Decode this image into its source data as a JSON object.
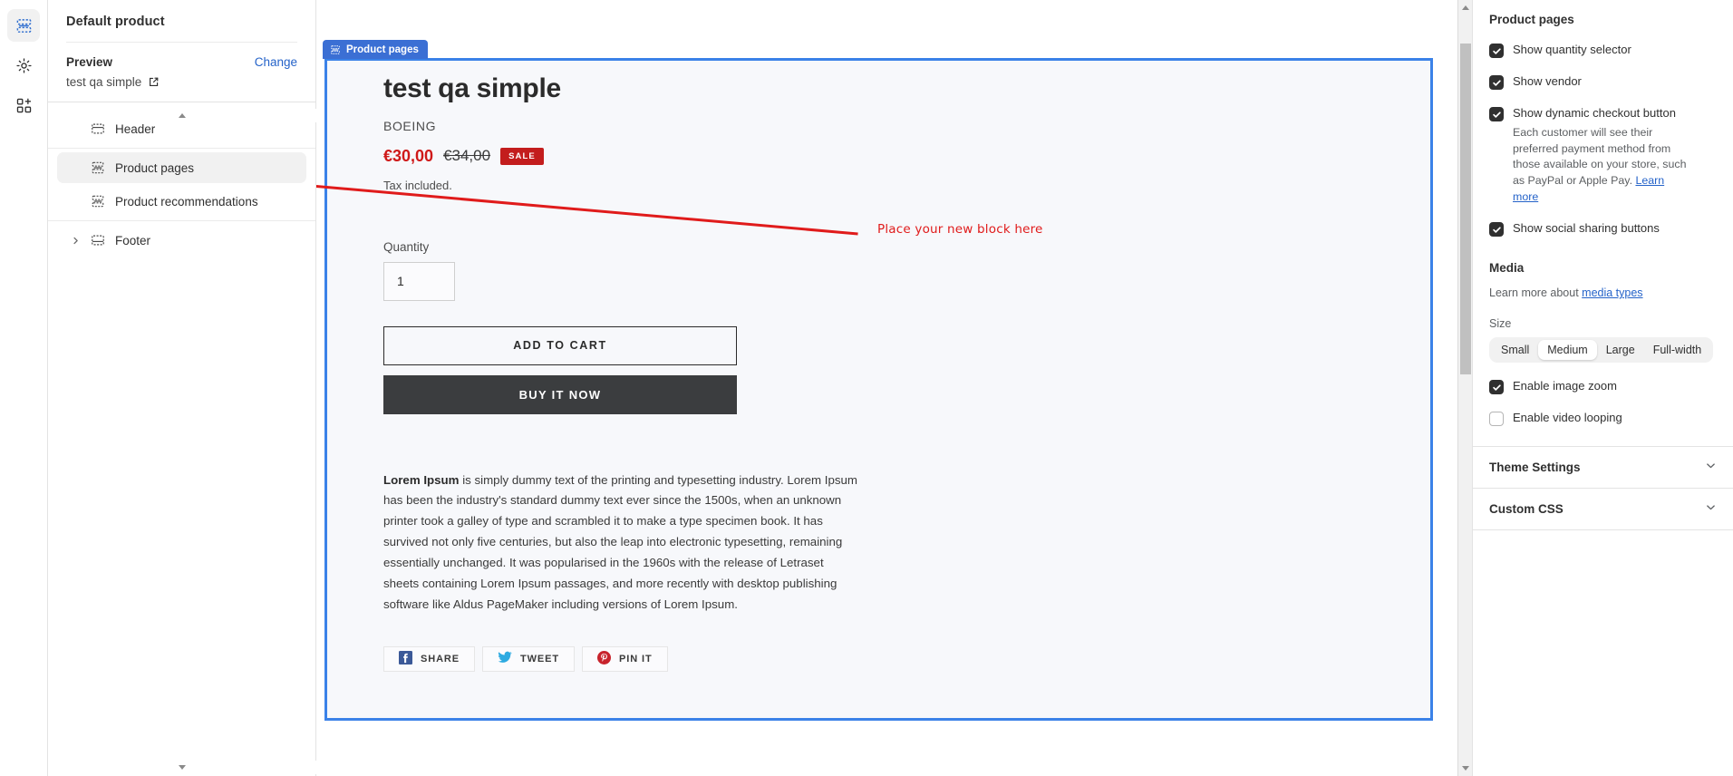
{
  "rail": {
    "items": [
      {
        "name": "sections-icon",
        "active": true
      },
      {
        "name": "settings-gear-icon",
        "active": false
      },
      {
        "name": "apps-add-icon",
        "active": false
      }
    ]
  },
  "sidebar": {
    "title": "Default product",
    "preview": {
      "label": "Preview",
      "change_label": "Change",
      "value": "test qa simple"
    },
    "tree": [
      {
        "label": "Header",
        "icon": "header-section-icon",
        "selected": false,
        "twisty": false
      },
      {
        "label": "Product pages",
        "icon": "section-icon",
        "selected": true,
        "twisty": false
      },
      {
        "label": "Product recommendations",
        "icon": "section-icon",
        "selected": false,
        "twisty": false
      },
      {
        "label": "Footer",
        "icon": "footer-section-icon",
        "selected": false,
        "twisty": true
      }
    ]
  },
  "canvas": {
    "section_tab_label": "Product pages",
    "annotation": "Place your new block here",
    "annotation_color": "#e01b1b",
    "product": {
      "title": "test qa simple",
      "vendor": "BOEING",
      "price_sale": "€30,00",
      "price_compare": "€34,00",
      "sale_badge": "SALE",
      "tax_note": "Tax included.",
      "quantity_label": "Quantity",
      "quantity_value": "1",
      "add_to_cart_label": "ADD TO CART",
      "buy_it_now_label": "BUY IT NOW",
      "description_lead": "Lorem Ipsum",
      "description_rest": " is simply dummy text of the printing and typesetting industry. Lorem Ipsum has been the industry's standard dummy text ever since the 1500s, when an unknown printer took a galley of type and scrambled it to make a type specimen book. It has survived not only five centuries, but also the leap into electronic typesetting, remaining essentially unchanged. It was popularised in the 1960s with the release of Letraset sheets containing Lorem Ipsum passages, and more recently with desktop publishing software like Aldus PageMaker including versions of Lorem Ipsum.",
      "share_buttons": [
        {
          "label": "SHARE",
          "icon": "facebook-icon",
          "color": "#3b5998"
        },
        {
          "label": "TWEET",
          "icon": "twitter-icon",
          "color": "#2daae1"
        },
        {
          "label": "PIN IT",
          "icon": "pinterest-icon",
          "color": "#c8232c"
        }
      ]
    }
  },
  "right_panel": {
    "title": "Product pages",
    "checkboxes": [
      {
        "label": "Show quantity selector",
        "checked": true
      },
      {
        "label": "Show vendor",
        "checked": true
      },
      {
        "label": "Show dynamic checkout button",
        "checked": true,
        "help": "Each customer will see their preferred payment method from those available on your store, such as PayPal or Apple Pay. ",
        "help_link": "Learn more"
      },
      {
        "label": "Show social sharing buttons",
        "checked": true
      }
    ],
    "media": {
      "title": "Media",
      "learn_prefix": "Learn more about ",
      "learn_link": "media types",
      "size_label": "Size",
      "size_options": [
        "Small",
        "Medium",
        "Large",
        "Full-width"
      ],
      "size_selected": "Medium",
      "enable_image_zoom": {
        "label": "Enable image zoom",
        "checked": true
      },
      "enable_video_looping": {
        "label": "Enable video looping",
        "checked": false
      }
    },
    "accordions": [
      {
        "label": "Theme Settings"
      },
      {
        "label": "Custom CSS"
      }
    ]
  },
  "colors": {
    "accent_blue": "#3b82e8",
    "tab_blue": "#3b6fd4",
    "link_blue": "#2563c9",
    "sale_red": "#c31d1d",
    "annotation_red": "#e01b1b"
  }
}
